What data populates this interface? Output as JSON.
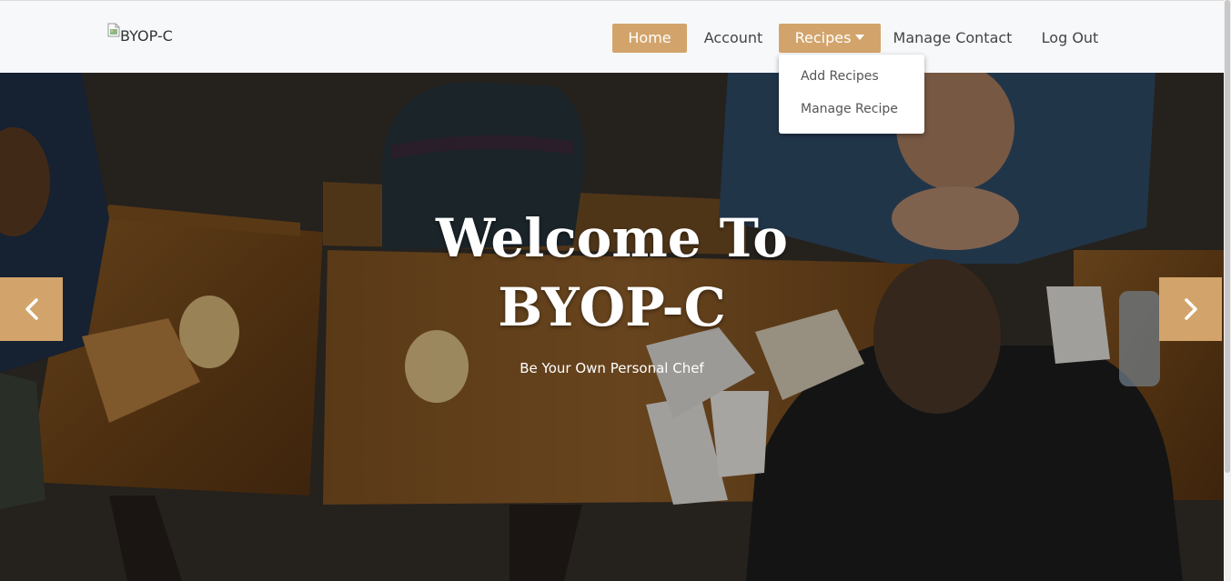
{
  "brand": {
    "alt_text": "BYOP-C"
  },
  "nav": {
    "home": "Home",
    "account": "Account",
    "recipes": "Recipes",
    "manage_contact": "Manage Contact",
    "logout": "Log Out"
  },
  "recipes_menu": [
    "Add Recipes",
    "Manage Recipe"
  ],
  "hero": {
    "title_line1": "Welcome To",
    "title_line2": "BYOP-C",
    "subtitle": "Be Your Own Personal Chef"
  },
  "colors": {
    "accent": "#d2a46b",
    "navbar_bg": "#f7f8fa",
    "hero_text": "#ffffff"
  },
  "icons": {
    "prev": "chevron-left-icon",
    "next": "chevron-right-icon",
    "caret": "caret-down-icon",
    "brand": "broken-image-icon"
  }
}
